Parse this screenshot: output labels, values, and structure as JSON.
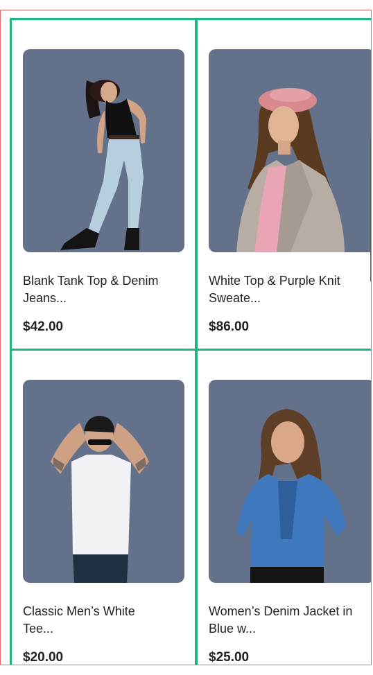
{
  "products": [
    {
      "title": "Blank Tank Top & Denim\nJeans...",
      "price": "$42.00",
      "image": "woman-tank-top-jeans-photo"
    },
    {
      "title": "White Top & Purple Knit\nSweate...",
      "price": "$86.00",
      "image": "woman-pink-beret-coat-photo"
    },
    {
      "title": "Classic Men’s White\nTee...",
      "price": "$20.00",
      "image": "man-white-tee-sunglasses-photo"
    },
    {
      "title": "Women’s Denim Jacket in\nBlue w...",
      "price": "$25.00",
      "image": "woman-denim-jacket-photo"
    }
  ],
  "colors": {
    "card_border": "#1fb57f",
    "photo_bg": "#64718b",
    "frame_border": "#e46a6a"
  }
}
